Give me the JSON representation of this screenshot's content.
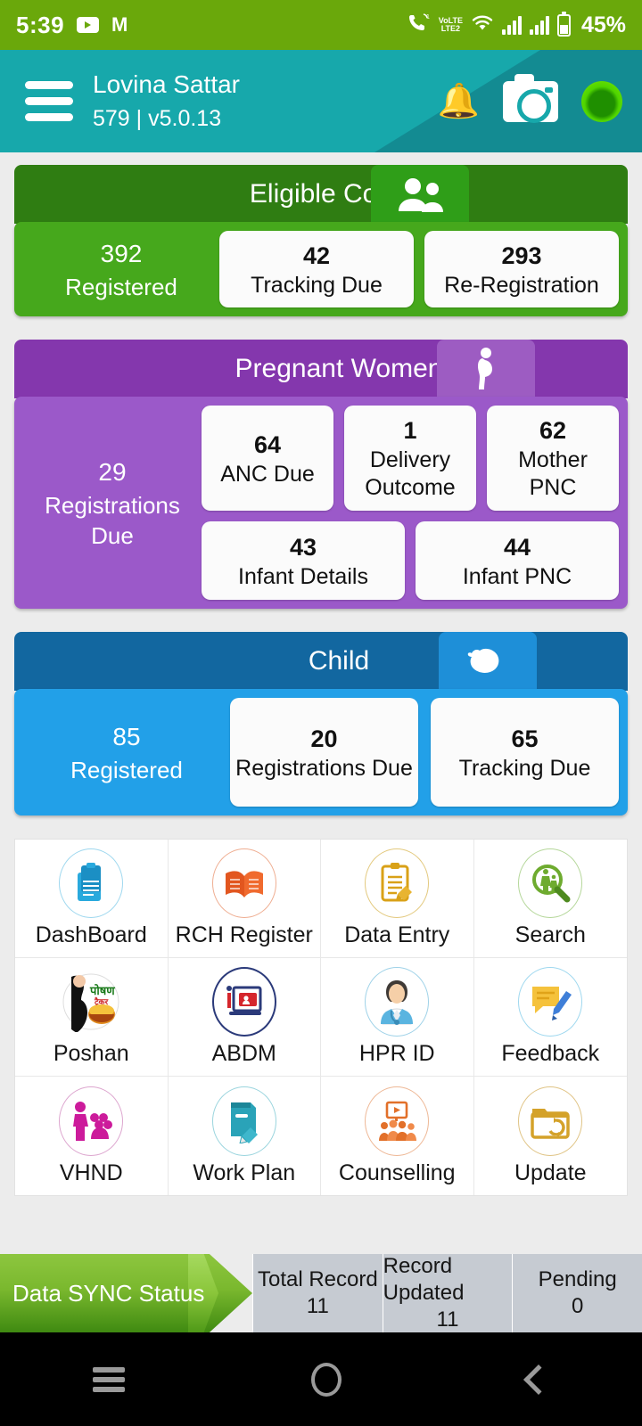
{
  "statusbar": {
    "time": "5:39",
    "youtube_icon": "youtube-icon",
    "gmail_icon": "gmail-icon",
    "call_icon": "volte-call-icon",
    "network_label": "VoLTE2",
    "network_top": "VoLTE",
    "network_bottom": "LTE2",
    "wifi_icon": "wifi-icon",
    "battery_percent": "45%"
  },
  "header": {
    "menu_icon": "hamburger-menu-icon",
    "user_name": "Lovina Sattar",
    "user_sub": "579 | v5.0.13",
    "bell_icon": "notification-bell-icon",
    "bell_glyph": "🔔",
    "camera_icon": "camera-icon",
    "status_icon": "online-status-indicator"
  },
  "cards": [
    {
      "id": "eligible-couple",
      "title": "Eligible Couple",
      "badge_icon": "couple-icon",
      "left": {
        "number": "392",
        "label": "Registered"
      },
      "tiles": [
        {
          "number": "42",
          "label": "Tracking Due"
        },
        {
          "number": "293",
          "label": "Re-Registration"
        }
      ]
    },
    {
      "id": "pregnant-women",
      "title": "Pregnant Women",
      "badge_icon": "pregnant-woman-icon",
      "left": {
        "number": "29",
        "label": "Registrations Due"
      },
      "tiles_row1": [
        {
          "number": "64",
          "label": "ANC Due"
        },
        {
          "number": "1",
          "label": "Delivery Outcome"
        },
        {
          "number": "62",
          "label": "Mother PNC"
        }
      ],
      "tiles_row2": [
        {
          "number": "43",
          "label": "Infant Details"
        },
        {
          "number": "44",
          "label": "Infant PNC"
        }
      ]
    },
    {
      "id": "child",
      "title": "Child",
      "badge_icon": "baby-icon",
      "left": {
        "number": "85",
        "label": "Registered"
      },
      "tiles": [
        {
          "number": "20",
          "label": "Registrations Due"
        },
        {
          "number": "65",
          "label": "Tracking Due"
        }
      ]
    }
  ],
  "menu_grid": [
    {
      "label": "DashBoard",
      "icon": "clipboard-dashboard-icon",
      "color": "#29a9dd"
    },
    {
      "label": "RCH Register",
      "icon": "open-book-icon",
      "color": "#e2561f"
    },
    {
      "label": "Data Entry",
      "icon": "clipboard-pencil-icon",
      "color": "#d9a117"
    },
    {
      "label": "Search",
      "icon": "search-family-icon",
      "color": "#6eab2f"
    },
    {
      "label": "Poshan",
      "icon": "poshan-tracker-icon",
      "color": "#1a7a1a"
    },
    {
      "label": "ABDM",
      "icon": "abdm-id-card-icon",
      "color": "#2b3a7a"
    },
    {
      "label": "HPR ID",
      "icon": "doctor-icon",
      "color": "#3c9fd4"
    },
    {
      "label": "Feedback",
      "icon": "feedback-pencil-icon",
      "color": "#f5b731"
    },
    {
      "label": "VHND",
      "icon": "vhnd-community-icon",
      "color": "#cc1b9b"
    },
    {
      "label": "Work Plan",
      "icon": "notebook-pencil-icon",
      "color": "#2aa3b8"
    },
    {
      "label": "Counselling",
      "icon": "counselling-group-icon",
      "color": "#e2702a"
    },
    {
      "label": "Update",
      "icon": "folder-refresh-icon",
      "color": "#d4a22a"
    }
  ],
  "sync": {
    "banner_label": "Data SYNC Status",
    "cells": [
      {
        "label": "Total Record",
        "value": "11"
      },
      {
        "label": "Record Updated",
        "value": "11"
      },
      {
        "label": "Pending",
        "value": "0"
      }
    ]
  },
  "navbar": {
    "recents_icon": "recents-menu-icon",
    "home_icon": "home-circle-icon",
    "back_icon": "back-chevron-icon"
  },
  "colors": {
    "status_bar": "#6aa80b",
    "header": "#17a8ab",
    "header_dark": "#138b92",
    "eligible_couple": "#46a81c",
    "pregnant_women": "#9b59c9",
    "child": "#22a0e8",
    "sync_green": "#8dc63f",
    "page_bg": "#ececec"
  }
}
